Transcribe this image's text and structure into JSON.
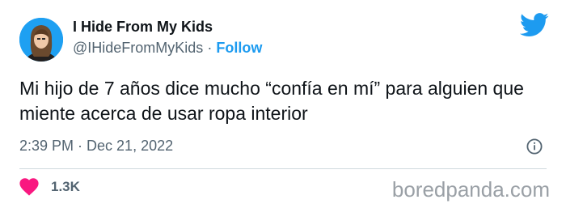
{
  "author": {
    "display_name": "I Hide From My Kids",
    "handle": "@IHideFromMyKids",
    "separator": "·",
    "follow_label": "Follow",
    "avatar_icon": "avatar-photo"
  },
  "tweet": {
    "text": "Mi hijo de 7 años dice mucho “confía en mí” para alguien que miente acerca de usar ropa interior",
    "timestamp": "2:39 PM · Dec 21, 2022"
  },
  "stats": {
    "likes": "1.3K"
  },
  "icons": {
    "platform": "twitter-bird-icon",
    "info": "info-icon",
    "like": "heart-icon"
  },
  "colors": {
    "accent": "#1d9bf0",
    "like": "#f91880",
    "secondary_text": "#536471"
  },
  "watermark": "boredpanda.com"
}
